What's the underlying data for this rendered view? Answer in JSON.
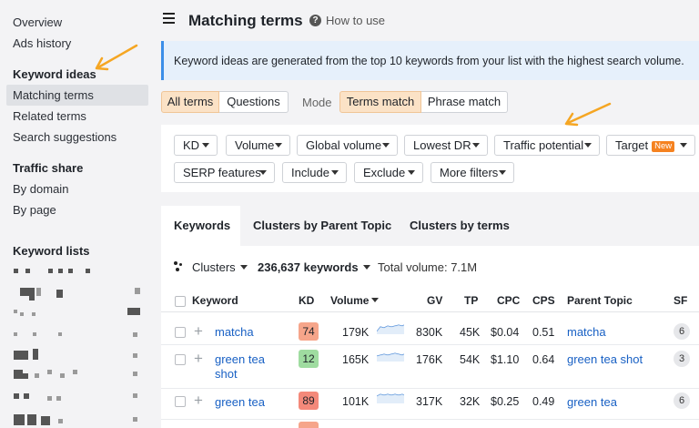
{
  "sidebar": {
    "items_top": [
      "Overview",
      "Ads history"
    ],
    "keyword_ideas": {
      "heading": "Keyword ideas",
      "items": [
        "Matching terms",
        "Related terms",
        "Search suggestions"
      ]
    },
    "traffic_share": {
      "heading": "Traffic share",
      "items": [
        "By domain",
        "By page"
      ]
    },
    "keyword_lists_heading": "Keyword lists"
  },
  "header": {
    "title": "Matching terms",
    "help_label": "How to use"
  },
  "info_banner": "Keyword ideas are generated from the top 10 keywords from your list with the highest search volume.",
  "segments": {
    "all_terms": "All terms",
    "questions": "Questions",
    "mode_label": "Mode",
    "terms_match": "Terms match",
    "phrase_match": "Phrase match"
  },
  "filters": {
    "kd": "KD",
    "volume": "Volume",
    "global_volume": "Global volume",
    "lowest_dr": "Lowest DR",
    "traffic_potential": "Traffic potential",
    "target": "Target",
    "target_badge": "New",
    "serp_features": "SERP features",
    "include": "Include",
    "exclude": "Exclude",
    "more_filters": "More filters"
  },
  "tabs": [
    "Keywords",
    "Clusters by Parent Topic",
    "Clusters by terms"
  ],
  "toolbar": {
    "clusters": "Clusters",
    "keyword_count": "236,637 keywords",
    "total_volume": "Total volume: 7.1M"
  },
  "table": {
    "columns": {
      "keyword": "Keyword",
      "kd": "KD",
      "volume": "Volume",
      "gv": "GV",
      "tp": "TP",
      "cpc": "CPC",
      "cps": "CPS",
      "parent_topic": "Parent Topic",
      "sf": "SF"
    },
    "rows": [
      {
        "keyword_line1": "matcha",
        "keyword_line2": "",
        "kd": "74",
        "kd_color": "#f6a58a",
        "volume": "179K",
        "gv": "830K",
        "tp": "45K",
        "cpc": "$0.04",
        "cps": "0.51",
        "parent_topic": "matcha",
        "sf": "6"
      },
      {
        "keyword_line1": "green tea",
        "keyword_line2": "shot",
        "kd": "12",
        "kd_color": "#9fdca0",
        "volume": "165K",
        "gv": "176K",
        "tp": "54K",
        "cpc": "$1.10",
        "cps": "0.64",
        "parent_topic": "green tea shot",
        "sf": "3"
      },
      {
        "keyword_line1": "green tea",
        "keyword_line2": "",
        "kd": "89",
        "kd_color": "#f4897a",
        "volume": "101K",
        "gv": "317K",
        "tp": "32K",
        "cpc": "$0.25",
        "cps": "0.49",
        "parent_topic": "green tea",
        "sf": "6"
      }
    ]
  },
  "colors": {
    "accent_orange": "#f58220",
    "link_blue": "#1860c4",
    "segment_active": "#fbe2c6",
    "banner_bg": "#e6f0fb"
  }
}
